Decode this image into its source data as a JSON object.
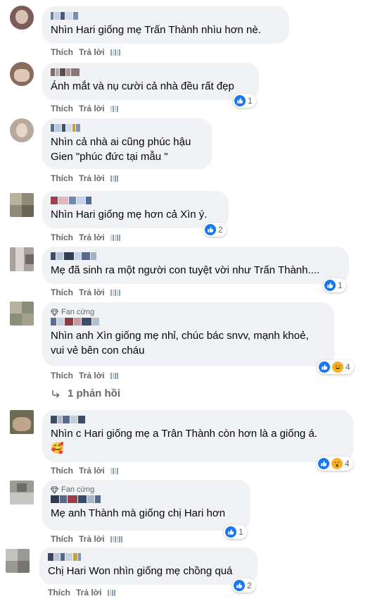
{
  "actions": {
    "like": "Thích",
    "reply": "Trả lời"
  },
  "badge": {
    "fan": "Fan cứng"
  },
  "comments": [
    {
      "text": "Nhìn Hari giống mẹ Trấn Thành nhìu hơn nè.",
      "reactions": ""
    },
    {
      "text": "Ánh mắt và nụ cười cả nhà đều rất đẹp",
      "reactions": "1"
    },
    {
      "text": "Nhìn cả nhà ai cũng phúc hậu\nGien \"phúc đức tại mẫu \"",
      "reactions": ""
    },
    {
      "text": "Nhìn Hari giống mẹ hơn cả Xìn ý.",
      "reactions": "2"
    },
    {
      "text": "Mẹ đã sinh ra một người con tuyệt vời như Trấn Thành....",
      "reactions": "1"
    },
    {
      "text": "Nhìn anh Xìn giống mẹ nhỉ, chúc bác snvv, mạnh khoẻ,\nvui vẻ bên con cháu",
      "reactions": "4"
    },
    {
      "text": "Nhìn c Hari giống mẹ a Trân Thành còn hơn là a giống á.\n🥰",
      "reactions": "4"
    },
    {
      "text": "Mẹ anh Thành mà giống chị Hari hơn",
      "reactions": "1"
    },
    {
      "text": "Chị Hari Won nhìn giống mẹ chồng quá",
      "reactions": "2"
    }
  ],
  "replies": {
    "label": "1 phản hồi"
  },
  "colors": {
    "bubble": "#f0f2f5",
    "like": "#1877f2",
    "meta": "#65676b"
  }
}
